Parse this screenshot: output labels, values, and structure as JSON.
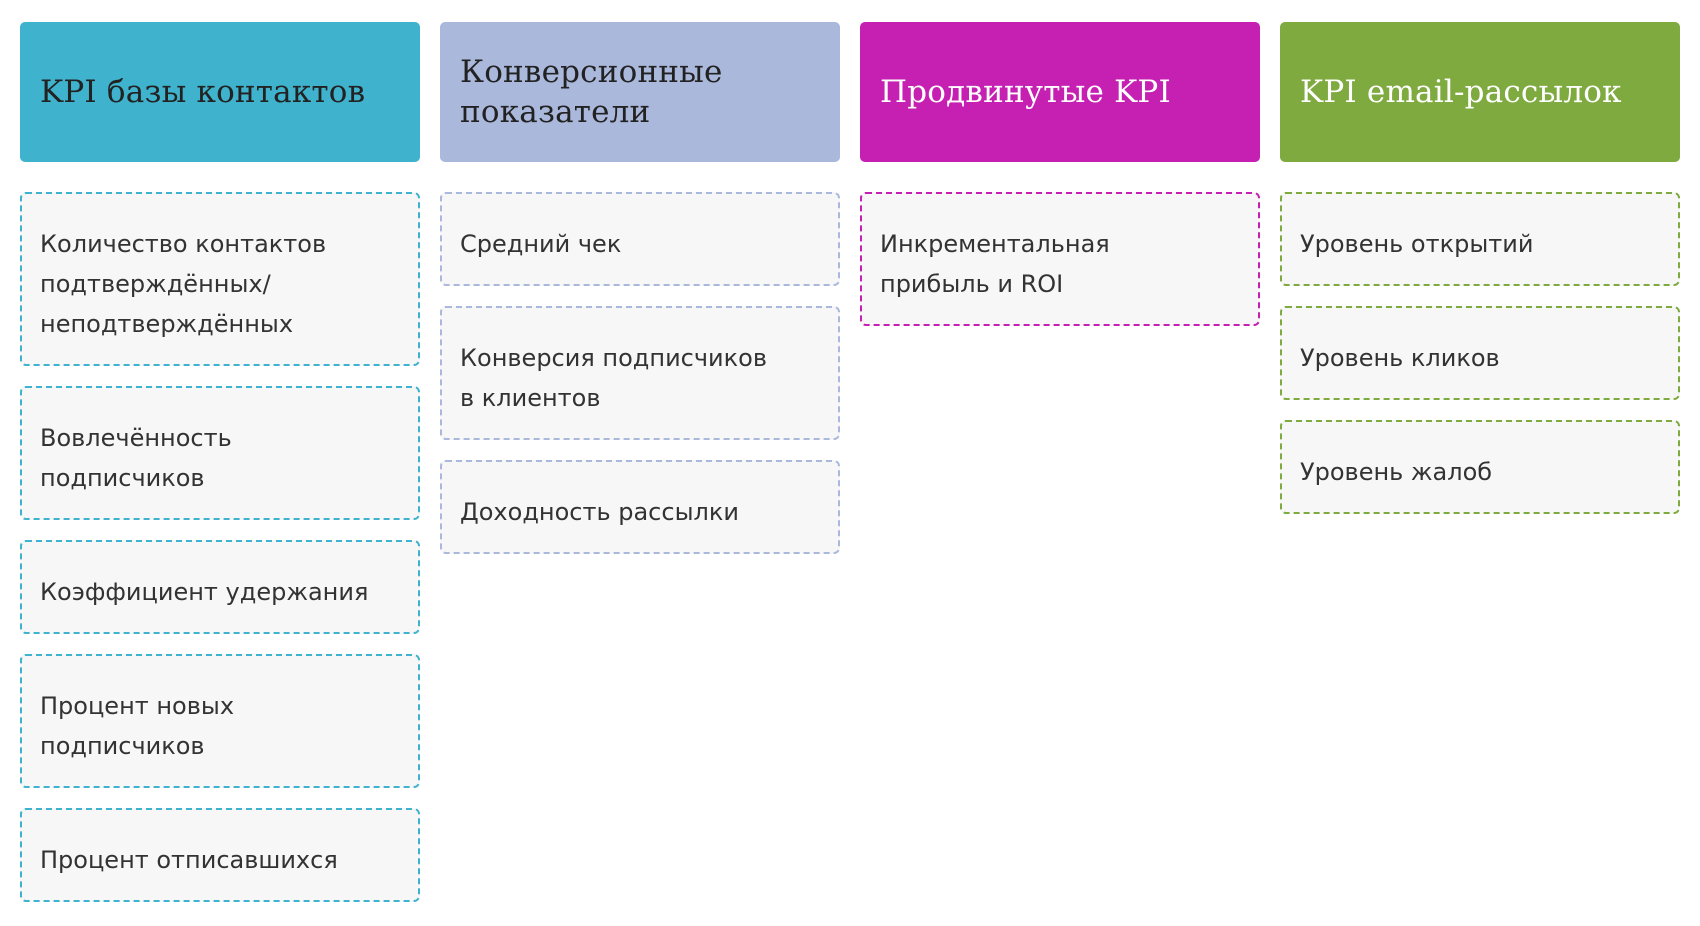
{
  "columns": [
    {
      "title": "KPI базы контактов",
      "color": "#3fb3cd",
      "title_color": "#222222",
      "items": [
        {
          "label": "Количество контактов\nподтверждённых/\nнеподтверждённых",
          "lines": 3
        },
        {
          "label": "Вовлечённость\nподписчиков",
          "lines": 2
        },
        {
          "label": "Коэффициент удержания",
          "lines": 1
        },
        {
          "label": "Процент новых\nподписчиков",
          "lines": 2
        },
        {
          "label": "Процент отписавшихся",
          "lines": 1
        }
      ]
    },
    {
      "title": "Конверсионные\nпоказатели",
      "color": "#aab8dc",
      "title_color": "#222222",
      "items": [
        {
          "label": "Средний чек",
          "lines": 1
        },
        {
          "label": "Конверсия подписчиков\nв клиентов",
          "lines": 2
        },
        {
          "label": "Доходность рассылки",
          "lines": 1
        }
      ]
    },
    {
      "title": "Продвинутые KPI",
      "color": "#c520b2",
      "title_color": "#ffffff",
      "items": [
        {
          "label": "Инкрементальная\nприбыль и ROI",
          "lines": 2
        }
      ]
    },
    {
      "title": "KPI email-рассылок",
      "color": "#7eaa3f",
      "title_color": "#ffffff",
      "items": [
        {
          "label": "Уровень открытий",
          "lines": 1
        },
        {
          "label": "Уровень кликов",
          "lines": 1
        },
        {
          "label": "Уровень жалоб",
          "lines": 1
        }
      ]
    }
  ]
}
